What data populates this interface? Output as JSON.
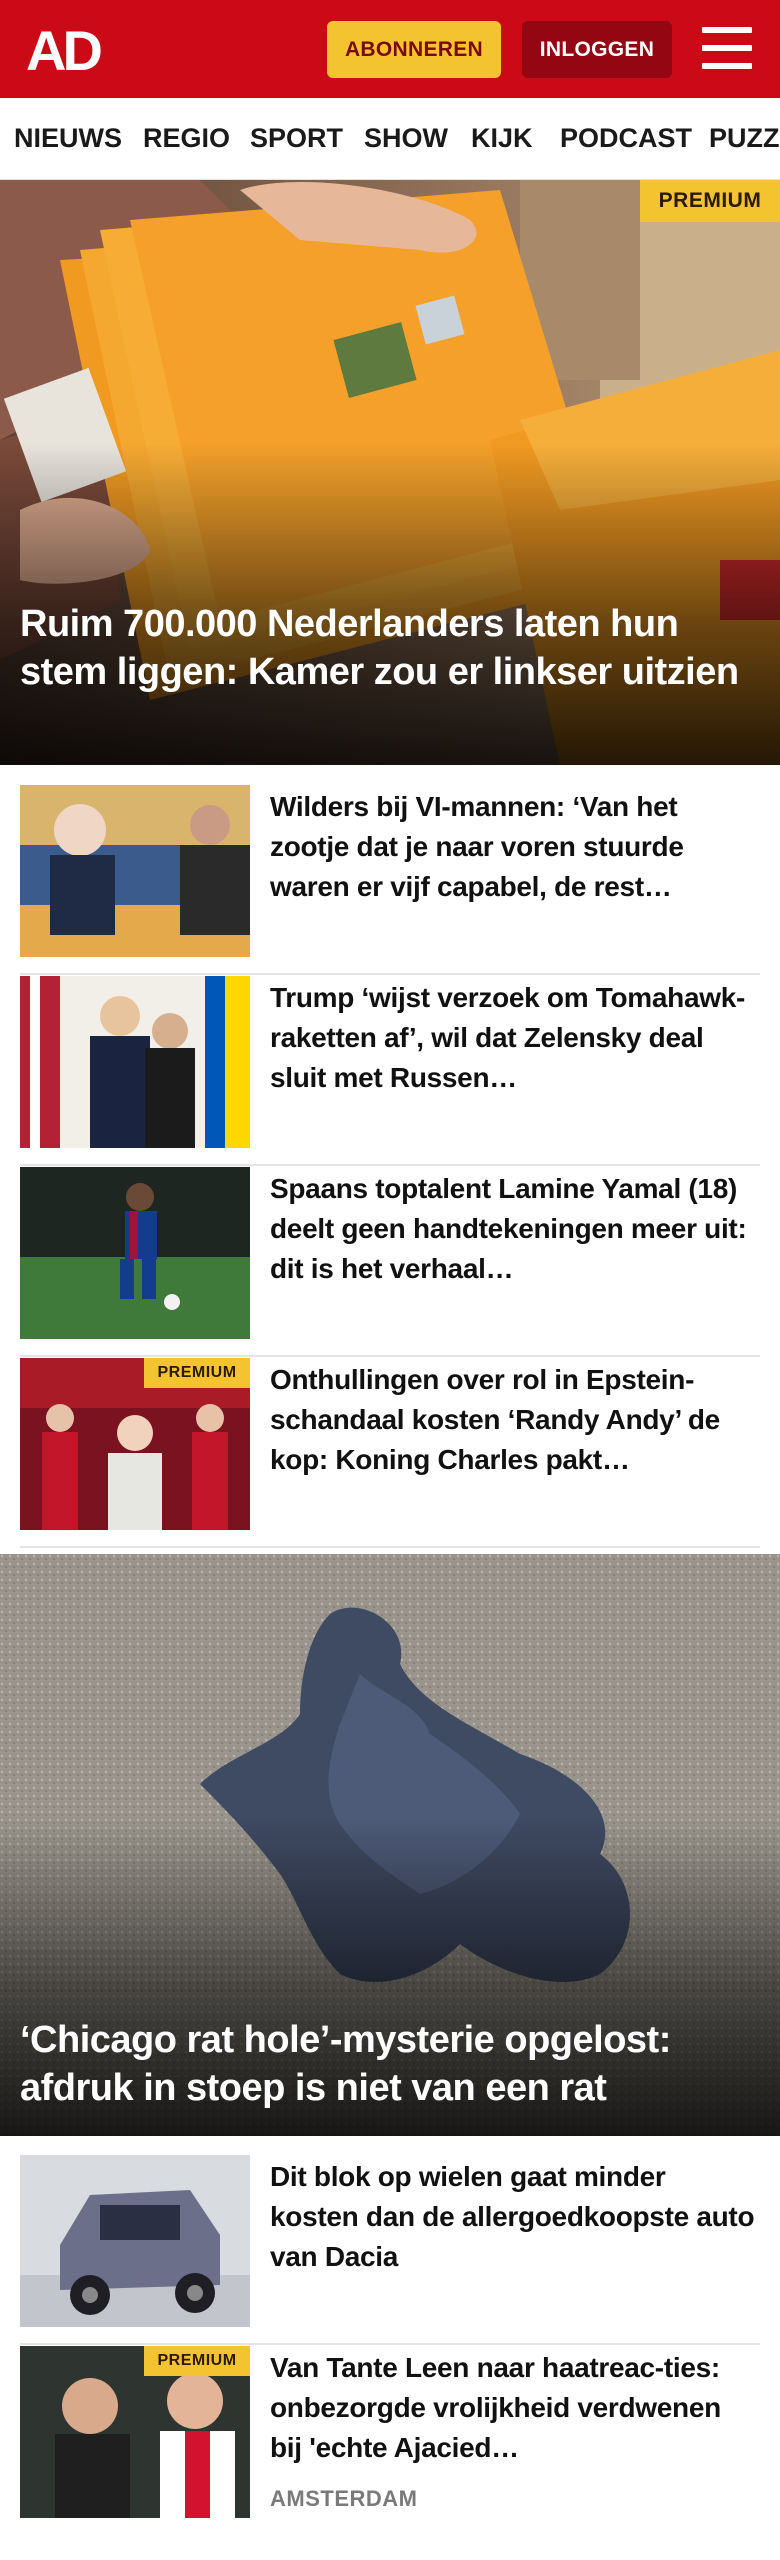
{
  "header": {
    "logo_text": "AD",
    "subscribe_label": "ABONNEREN",
    "login_label": "INLOGGEN",
    "menu_icon": "hamburger-menu-icon",
    "brand_color": "#cc0a17",
    "subscribe_color": "#f4c430",
    "login_color": "#930612"
  },
  "nav": {
    "items": [
      {
        "label": "NIEUWS"
      },
      {
        "label": "REGIO"
      },
      {
        "label": "SPORT"
      },
      {
        "label": "SHOW"
      },
      {
        "label": "KIJK"
      },
      {
        "label": "PODCAST"
      },
      {
        "label": "PUZZ"
      }
    ]
  },
  "hero1": {
    "badge": "PREMIUM",
    "title": "Ruim 700.000 Nederlanders laten hun stem liggen: Kamer zou er linkser uitzien"
  },
  "articles": [
    {
      "title": "Wilders bij VI-mannen: ‘Van het zootje dat je naar voren stuurde waren er vijf capabel, de rest…",
      "badge": "",
      "label": ""
    },
    {
      "title": "Trump ‘wijst verzoek om Tomahawk-raketten af’, wil dat Zelensky deal sluit met Russen…",
      "badge": "",
      "label": ""
    },
    {
      "title": "Spaans toptalent Lamine Yamal (18) deelt geen handtekeningen meer uit: dit is het verhaal…",
      "badge": "",
      "label": ""
    },
    {
      "title": "Onthullingen over rol in Epstein-schandaal kosten ‘Randy Andy’ de kop: Koning Charles pakt…",
      "badge": "PREMIUM",
      "label": ""
    }
  ],
  "hero2": {
    "title": "‘Chicago rat hole’-mysterie opgelost: afdruk in stoep is niet van een rat"
  },
  "articles2": [
    {
      "title": "Dit blok op wielen gaat minder kosten dan de allergoedkoopste auto van Dacia",
      "badge": "",
      "label": ""
    },
    {
      "title": "Van Tante Leen naar haatreac-ties: onbezorgde vrolijkheid verdwenen bij 'echte Ajacied…",
      "badge": "PREMIUM",
      "label": "AMSTERDAM"
    }
  ]
}
